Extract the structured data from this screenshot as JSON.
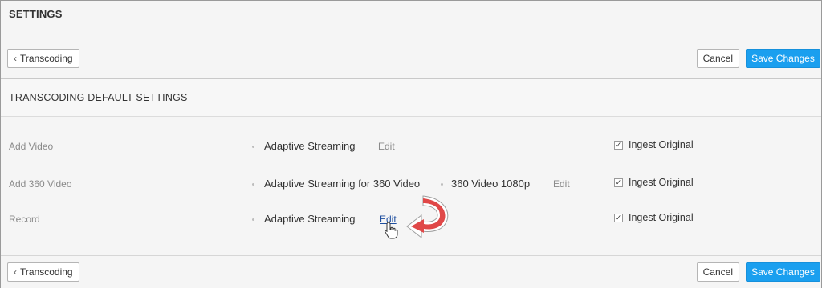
{
  "page": {
    "title": "SETTINGS"
  },
  "toolbar": {
    "back_label": "Transcoding",
    "cancel_label": "Cancel",
    "save_label": "Save Changes"
  },
  "section": {
    "title": "TRANSCODING DEFAULT SETTINGS"
  },
  "rows": [
    {
      "label": "Add Video",
      "preset": "Adaptive Streaming",
      "extra": "",
      "edit": "Edit",
      "ingest": "Ingest Original",
      "ingest_checked": true
    },
    {
      "label": "Add 360 Video",
      "preset": "Adaptive Streaming for 360 Video",
      "extra": "360 Video 1080p",
      "edit": "Edit",
      "ingest": "Ingest Original",
      "ingest_checked": true
    },
    {
      "label": "Record",
      "preset": "Adaptive Streaming",
      "extra": "",
      "edit": "Edit",
      "ingest": "Ingest Original",
      "ingest_checked": true
    }
  ],
  "colors": {
    "primary": "#1a9fef",
    "link": "#1f4fa0",
    "arrow": "#e04848"
  },
  "icons": {
    "back": "chevron-left-icon",
    "checkbox": "checkbox-checked-icon",
    "pointer": "hand-pointer-icon",
    "annotation": "curved-arrow-icon"
  }
}
